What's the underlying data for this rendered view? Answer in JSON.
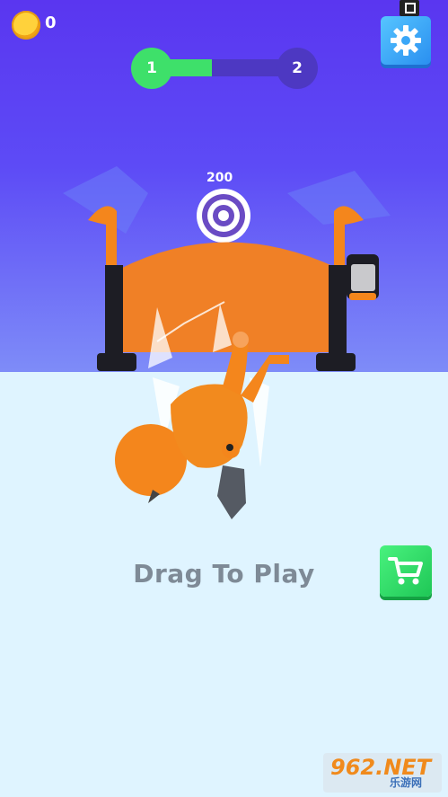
{
  "hud": {
    "coins": "0",
    "level_current": "1",
    "level_next": "2",
    "level_progress": 0.41
  },
  "target": {
    "points": "200"
  },
  "hint": {
    "text": "Drag To Play"
  },
  "watermark": {
    "brand": "962.NET",
    "sub": "乐游网"
  },
  "icons": {
    "coin": "coin-icon",
    "settings": "gear-icon",
    "shop": "shopping-cart-icon",
    "capture": "screen-capture-icon"
  },
  "colors": {
    "sky": "#5a36f0",
    "floor": "#dff4ff",
    "progress_fill": "#3ee06a",
    "progress_track": "#4d38c2",
    "character": "#f4861c",
    "settings_button": "#3aa7f8",
    "shop_button": "#2fd566"
  }
}
